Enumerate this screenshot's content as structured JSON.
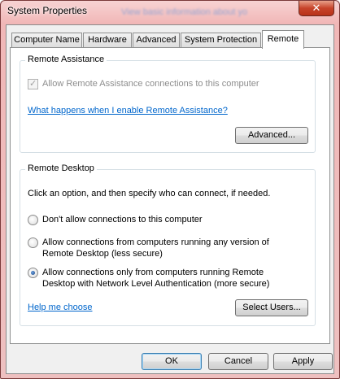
{
  "window": {
    "title": "System Properties",
    "background_text": "View basic information about yo",
    "close_label": "✕"
  },
  "tabs": [
    {
      "label": "Computer Name",
      "active": false
    },
    {
      "label": "Hardware",
      "active": false
    },
    {
      "label": "Advanced",
      "active": false
    },
    {
      "label": "System Protection",
      "active": false
    },
    {
      "label": "Remote",
      "active": true
    }
  ],
  "remote_assistance": {
    "group_title": "Remote Assistance",
    "allow_checkbox_label": "Allow Remote Assistance connections to this computer",
    "allow_checked": true,
    "help_link": "What happens when I enable Remote Assistance?",
    "advanced_button": "Advanced..."
  },
  "remote_desktop": {
    "group_title": "Remote Desktop",
    "instructions": "Click an option, and then specify who can connect, if needed.",
    "options": [
      {
        "label": "Don't allow connections to this computer",
        "selected": false
      },
      {
        "label": "Allow connections from computers running any version of Remote Desktop (less secure)",
        "selected": false
      },
      {
        "label": "Allow connections only from computers running Remote Desktop with Network Level Authentication (more secure)",
        "selected": true
      }
    ],
    "help_link": "Help me choose",
    "select_users_button": "Select Users..."
  },
  "footer": {
    "ok": "OK",
    "cancel": "Cancel",
    "apply": "Apply"
  },
  "colors": {
    "link": "#0066cc",
    "title_bar": "#f1b7b7",
    "close_button": "#c7442b"
  }
}
